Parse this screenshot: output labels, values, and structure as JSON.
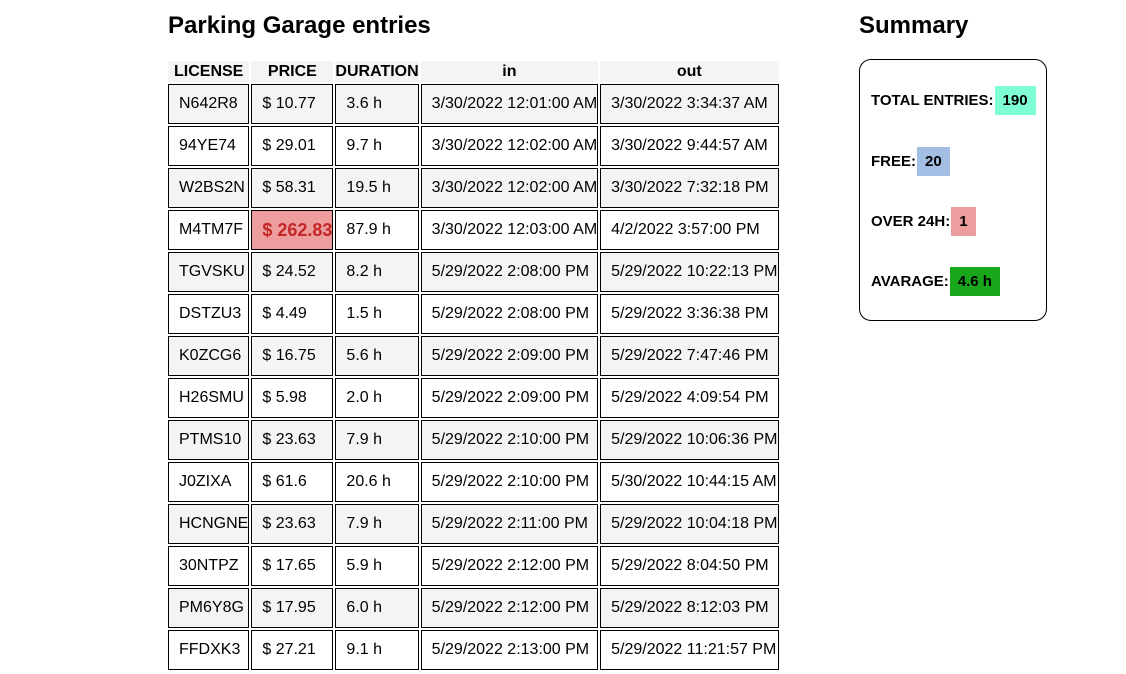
{
  "entries": {
    "title": "Parking Garage entries",
    "columns": [
      "LICENSE",
      "PRICE",
      "DURATION",
      "in",
      "out"
    ],
    "rows": [
      {
        "license": "N642R8",
        "price": "$ 10.77",
        "duration": "3.6 h",
        "in": "3/30/2022 12:01:00 AM",
        "out": "3/30/2022 3:34:37 AM",
        "highlight": false
      },
      {
        "license": "94YE74",
        "price": "$ 29.01",
        "duration": "9.7 h",
        "in": "3/30/2022 12:02:00 AM",
        "out": "3/30/2022 9:44:57 AM",
        "highlight": false
      },
      {
        "license": "W2BS2N",
        "price": "$ 58.31",
        "duration": "19.5 h",
        "in": "3/30/2022 12:02:00 AM",
        "out": "3/30/2022 7:32:18 PM",
        "highlight": false
      },
      {
        "license": "M4TM7F",
        "price": "$ 262.83",
        "duration": "87.9 h",
        "in": "3/30/2022 12:03:00 AM",
        "out": "4/2/2022 3:57:00 PM",
        "highlight": true
      },
      {
        "license": "TGVSKU",
        "price": "$ 24.52",
        "duration": "8.2 h",
        "in": "5/29/2022 2:08:00 PM",
        "out": "5/29/2022 10:22:13 PM",
        "highlight": false
      },
      {
        "license": "DSTZU3",
        "price": "$ 4.49",
        "duration": "1.5 h",
        "in": "5/29/2022 2:08:00 PM",
        "out": "5/29/2022 3:36:38 PM",
        "highlight": false
      },
      {
        "license": "K0ZCG6",
        "price": "$ 16.75",
        "duration": "5.6 h",
        "in": "5/29/2022 2:09:00 PM",
        "out": "5/29/2022 7:47:46 PM",
        "highlight": false
      },
      {
        "license": "H26SMU",
        "price": "$ 5.98",
        "duration": "2.0 h",
        "in": "5/29/2022 2:09:00 PM",
        "out": "5/29/2022 4:09:54 PM",
        "highlight": false
      },
      {
        "license": "PTMS10",
        "price": "$ 23.63",
        "duration": "7.9 h",
        "in": "5/29/2022 2:10:00 PM",
        "out": "5/29/2022 10:06:36 PM",
        "highlight": false
      },
      {
        "license": "J0ZIXA",
        "price": "$ 61.6",
        "duration": "20.6 h",
        "in": "5/29/2022 2:10:00 PM",
        "out": "5/30/2022 10:44:15 AM",
        "highlight": false
      },
      {
        "license": "HCNGNE",
        "price": "$ 23.63",
        "duration": "7.9 h",
        "in": "5/29/2022 2:11:00 PM",
        "out": "5/29/2022 10:04:18 PM",
        "highlight": false
      },
      {
        "license": "30NTPZ",
        "price": "$ 17.65",
        "duration": "5.9 h",
        "in": "5/29/2022 2:12:00 PM",
        "out": "5/29/2022 8:04:50 PM",
        "highlight": false
      },
      {
        "license": "PM6Y8G",
        "price": "$ 17.95",
        "duration": "6.0 h",
        "in": "5/29/2022 2:12:00 PM",
        "out": "5/29/2022 8:12:03 PM",
        "highlight": false
      },
      {
        "license": "FFDXK3",
        "price": "$ 27.21",
        "duration": "9.1 h",
        "in": "5/29/2022 2:13:00 PM",
        "out": "5/29/2022 11:21:57 PM",
        "highlight": false
      }
    ]
  },
  "summary": {
    "title": "Summary",
    "total_label": "TOTAL ENTRIES:",
    "total_value": "190",
    "total_color": "#7fffd4",
    "free_label": "FREE:",
    "free_value": "20",
    "free_color": "#a3bee3",
    "over_label": "OVER 24H:",
    "over_value": "1",
    "over_color": "#ed9d9d",
    "avg_label": "AVARAGE:",
    "avg_value": "4.6 h",
    "avg_color": "#1aa61a"
  }
}
